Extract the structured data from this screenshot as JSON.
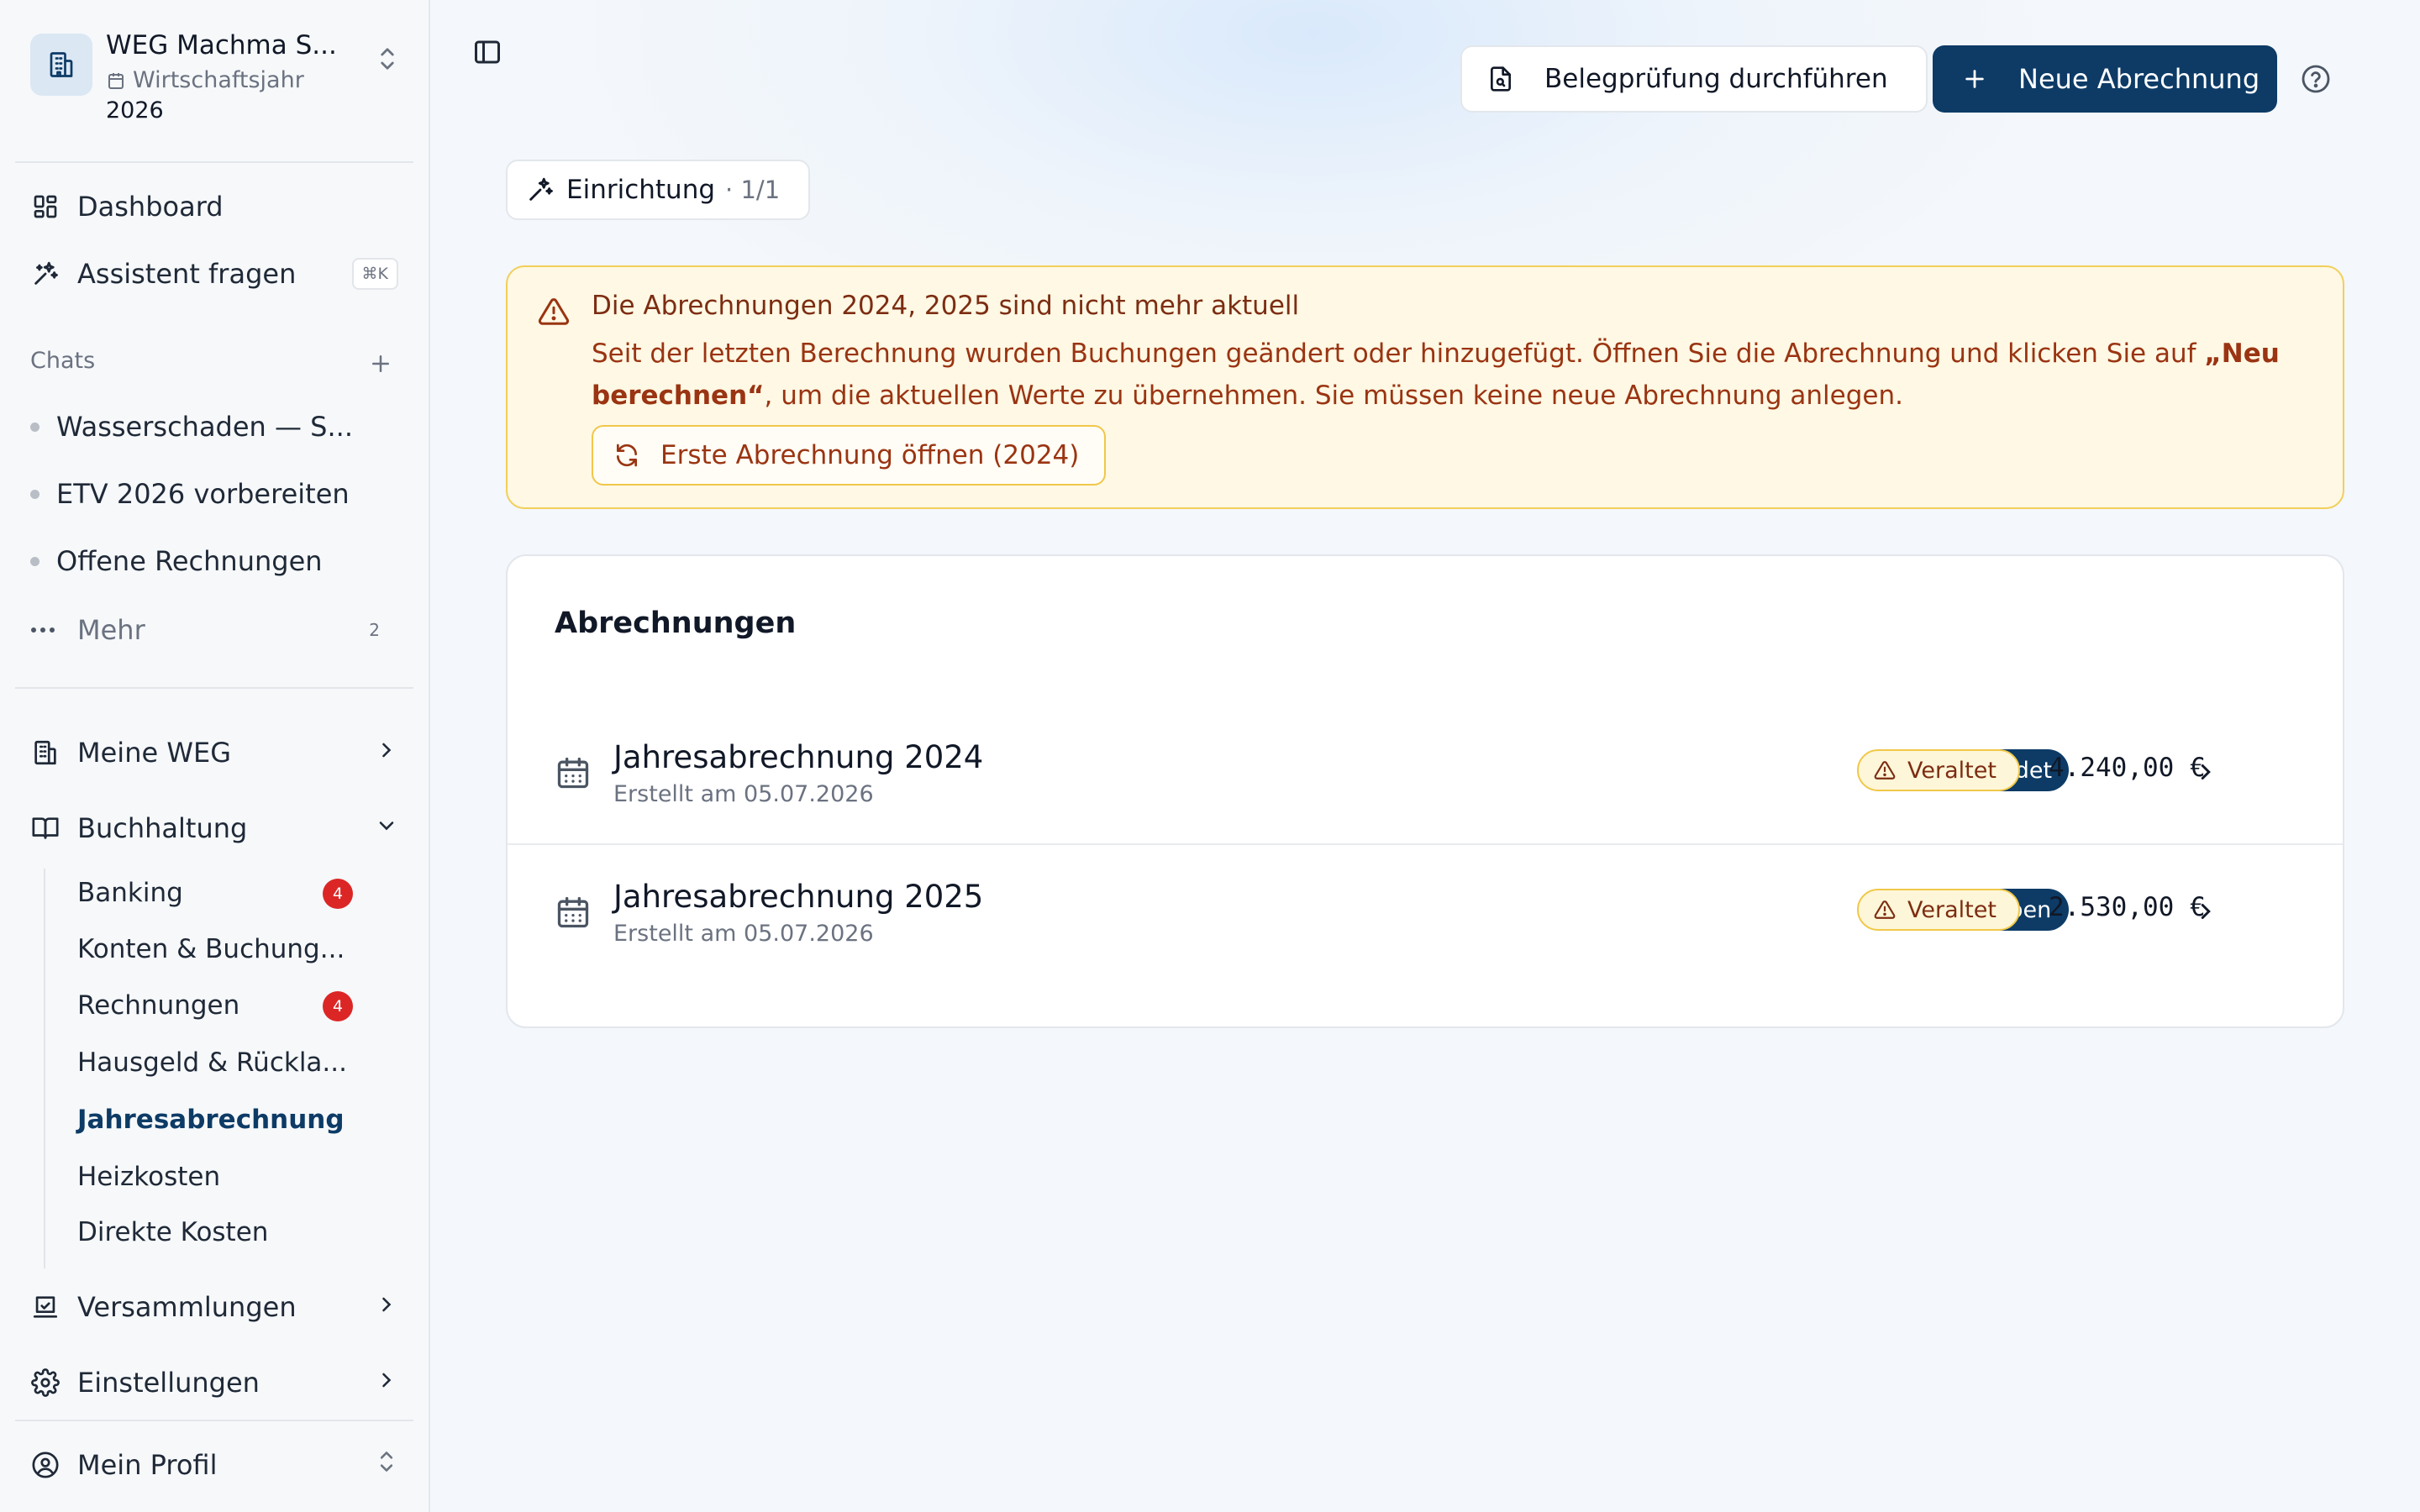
{
  "workspace": {
    "name": "WEG Machma S...",
    "subtitle": "Wirtschaftsjahr",
    "year": "2026"
  },
  "nav": {
    "dashboard": "Dashboard",
    "assistant": "Assistent fragen",
    "assistant_shortcut": "⌘K",
    "chats_label": "Chats",
    "chats": [
      "Wasserschaden — S...",
      "ETV 2026 vorbereiten",
      "Offene Rechnungen"
    ],
    "more_label": "Mehr",
    "more_count": "2",
    "meine_weg": "Meine WEG",
    "buchhaltung": "Buchhaltung",
    "buchhaltung_items": [
      {
        "label": "Banking",
        "badge": "4"
      },
      {
        "label": "Konten & Buchung...",
        "badge": ""
      },
      {
        "label": "Rechnungen",
        "badge": "4"
      },
      {
        "label": "Hausgeld & Rückla...",
        "badge": ""
      },
      {
        "label": "Jahresabrechnung",
        "badge": ""
      },
      {
        "label": "Heizkosten",
        "badge": ""
      },
      {
        "label": "Direkte Kosten",
        "badge": ""
      }
    ],
    "versammlungen": "Versammlungen",
    "einstellungen": "Einstellungen",
    "profile": "Mein Profil"
  },
  "header": {
    "belegpruefung": "Belegprüfung durchführen",
    "new_statement": "Neue Abrechnung"
  },
  "setup": {
    "label": "Einrichtung",
    "count": "· 1/1"
  },
  "alert": {
    "title": "Die Abrechnungen 2024, 2025 sind nicht mehr aktuell",
    "body_before": "Seit der letzten Berechnung wurden Buchungen geändert oder hinzugefügt. Öffnen Sie die Abrechnung und klicken Sie auf ",
    "body_bold": "„Neu berechnen“",
    "body_after": ", um die aktuellen Werte zu übernehmen. Sie müssen keine neue Abrechnung anlegen.",
    "button": "Erste Abrechnung öffnen (2024)"
  },
  "statements": {
    "title": "Abrechnungen",
    "rows": [
      {
        "title": "Jahresabrechnung 2024",
        "created": "Erstellt am 05.07.2026",
        "status": "Versendet",
        "stale": "Veraltet",
        "amount": "4.240,00 €"
      },
      {
        "title": "Jahresabrechnung 2025",
        "created": "Erstellt am 05.07.2026",
        "status": "Freigegeben",
        "stale": "Veraltet",
        "amount": "2.530,00 €"
      }
    ]
  },
  "colors": {
    "brand": "#0d3b66",
    "alert_bg": "#fef8e4",
    "alert_border": "#f2cf5a",
    "badge_red": "#dc2626"
  }
}
